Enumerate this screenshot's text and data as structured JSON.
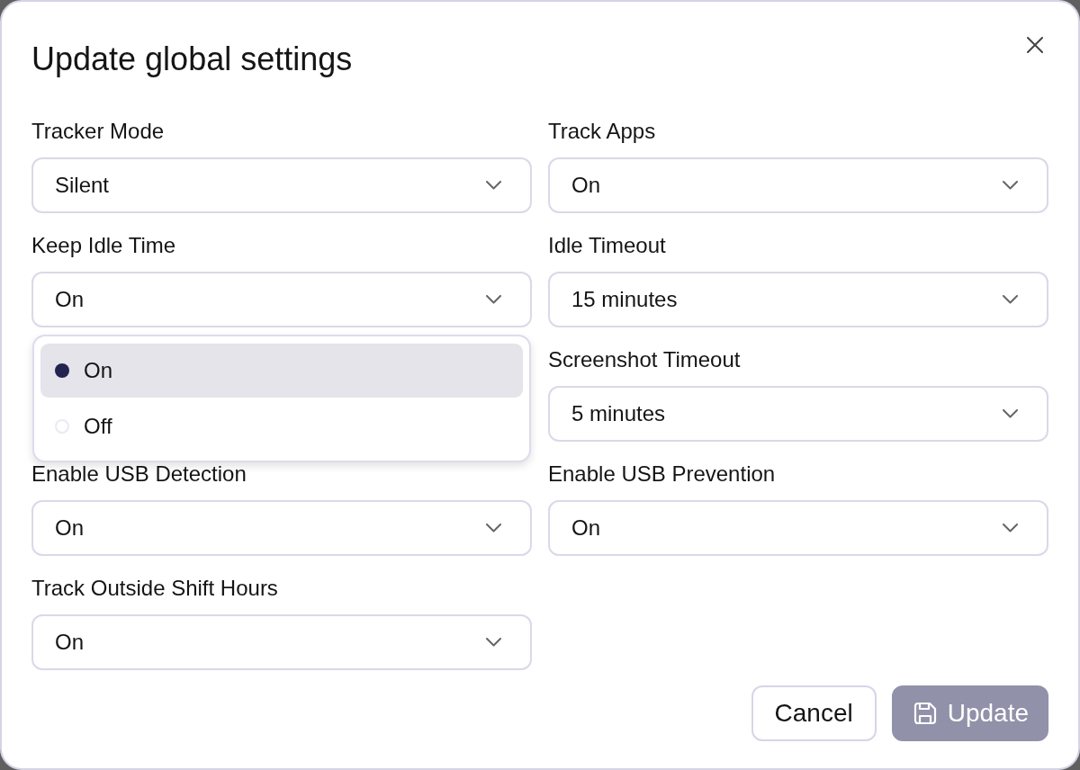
{
  "dialog": {
    "title": "Update global settings"
  },
  "rows": [
    {
      "left": {
        "label": "Tracker Mode",
        "value": "Silent"
      },
      "right": {
        "label": "Track Apps",
        "value": "On"
      }
    },
    {
      "left": {
        "label": "Keep Idle Time",
        "value": "On",
        "options": [
          {
            "label": "On",
            "selected": true
          },
          {
            "label": "Off",
            "selected": false
          }
        ]
      },
      "right": {
        "label": "Idle Timeout",
        "value": "15 minutes"
      }
    },
    {
      "right": {
        "label": "Screenshot Timeout",
        "value": "5 minutes"
      }
    },
    {
      "left": {
        "label": "Enable USB Detection",
        "value": "On"
      },
      "right": {
        "label": "Enable USB Prevention",
        "value": "On"
      }
    },
    {
      "left": {
        "label": "Track Outside Shift Hours",
        "value": "On"
      }
    }
  ],
  "buttons": [
    {
      "label": "Cancel",
      "kind": "secondary",
      "disabled": false
    },
    {
      "label": "Update",
      "kind": "submit",
      "disabled": true
    }
  ]
}
